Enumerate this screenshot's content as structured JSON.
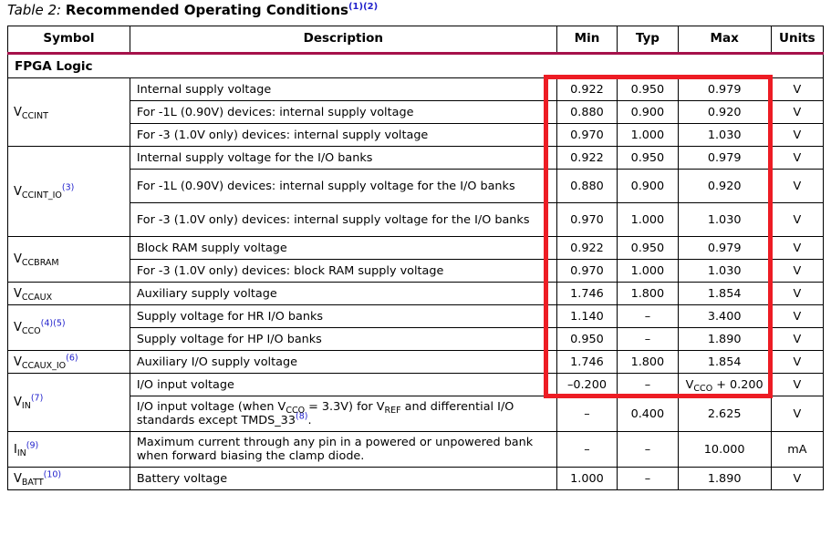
{
  "title": {
    "label": "Table  2:",
    "text": "Recommended Operating Conditions",
    "refs": "(1)(2)"
  },
  "columns": {
    "symbol": "Symbol",
    "description": "Description",
    "min": "Min",
    "typ": "Typ",
    "max": "Max",
    "units": "Units"
  },
  "section": {
    "fpga_logic": "FPGA Logic"
  },
  "symbols": {
    "vccint": {
      "base": "V",
      "sub": "CCINT",
      "refs": ""
    },
    "vccint_io": {
      "base": "V",
      "sub": "CCINT_IO",
      "refs": "(3)"
    },
    "vccbram": {
      "base": "V",
      "sub": "CCBRAM",
      "refs": ""
    },
    "vccaux": {
      "base": "V",
      "sub": "CCAUX",
      "refs": ""
    },
    "vcco": {
      "base": "V",
      "sub": "CCO",
      "refs": "(4)(5)"
    },
    "vccaux_io": {
      "base": "V",
      "sub": "CCAUX_IO",
      "refs": "(6)"
    },
    "vin": {
      "base": "V",
      "sub": "IN",
      "refs": "(7)"
    },
    "iin": {
      "base": "I",
      "sub": "IN",
      "refs": "(9)"
    },
    "vbatt": {
      "base": "V",
      "sub": "BATT",
      "refs": "(10)"
    }
  },
  "rows": [
    {
      "id": "vccint-1",
      "description": "Internal supply voltage",
      "min": "0.922",
      "typ": "0.950",
      "max": "0.979",
      "units": "V"
    },
    {
      "id": "vccint-2",
      "description": "For -1L (0.90V) devices: internal supply voltage",
      "min": "0.880",
      "typ": "0.900",
      "max": "0.920",
      "units": "V"
    },
    {
      "id": "vccint-3",
      "description": "For -3 (1.0V only) devices: internal supply voltage",
      "min": "0.970",
      "typ": "1.000",
      "max": "1.030",
      "units": "V"
    },
    {
      "id": "vccint-io-1",
      "description": "Internal supply voltage for the I/O banks",
      "min": "0.922",
      "typ": "0.950",
      "max": "0.979",
      "units": "V"
    },
    {
      "id": "vccint-io-2",
      "description": "For -1L (0.90V) devices: internal supply voltage for the I/O banks",
      "min": "0.880",
      "typ": "0.900",
      "max": "0.920",
      "units": "V"
    },
    {
      "id": "vccint-io-3",
      "description": "For -3 (1.0V only) devices: internal supply voltage for the I/O banks",
      "min": "0.970",
      "typ": "1.000",
      "max": "1.030",
      "units": "V"
    },
    {
      "id": "vccbram-1",
      "description": "Block RAM supply voltage",
      "min": "0.922",
      "typ": "0.950",
      "max": "0.979",
      "units": "V"
    },
    {
      "id": "vccbram-2",
      "description": "For -3 (1.0V only) devices: block RAM supply voltage",
      "min": "0.970",
      "typ": "1.000",
      "max": "1.030",
      "units": "V"
    },
    {
      "id": "vccaux-1",
      "description": "Auxiliary supply voltage",
      "min": "1.746",
      "typ": "1.800",
      "max": "1.854",
      "units": "V"
    },
    {
      "id": "vcco-1",
      "description": "Supply voltage for HR I/O banks",
      "min": "1.140",
      "typ": "–",
      "max": "3.400",
      "units": "V"
    },
    {
      "id": "vcco-2",
      "description": "Supply voltage for HP I/O banks",
      "min": "0.950",
      "typ": "–",
      "max": "1.890",
      "units": "V"
    },
    {
      "id": "vccaux-io-1",
      "description": "Auxiliary I/O supply voltage",
      "min": "1.746",
      "typ": "1.800",
      "max": "1.854",
      "units": "V"
    },
    {
      "id": "vin-1",
      "description": "I/O input voltage",
      "min": "–0.200",
      "typ": "–",
      "max_rich": true,
      "units": "V"
    },
    {
      "id": "vin-2",
      "description_rich": true,
      "min": "–",
      "typ": "0.400",
      "max": "2.625",
      "units": "V"
    },
    {
      "id": "iin-1",
      "description": "Maximum current through any pin in a powered or unpowered bank when forward biasing the clamp diode.",
      "min": "–",
      "typ": "–",
      "max": "10.000",
      "units": "mA"
    },
    {
      "id": "vbatt-1",
      "description": "Battery voltage",
      "min": "1.000",
      "typ": "–",
      "max": "1.890",
      "units": "V"
    }
  ],
  "inline": {
    "vin2_text_a": "I/O input voltage (when V",
    "vin2_sub_a": "CCO",
    "vin2_text_b": " = 3.3V) for V",
    "vin2_sub_b": "REF",
    "vin2_text_c": " and differential I/O standards except TMDS_33",
    "vin2_ref": "(8)",
    "vin2_text_d": ".",
    "vin1_max_base": "V",
    "vin1_max_sub": "CCO",
    "vin1_max_tail": " + 0.200"
  },
  "annotation": {
    "highlight_color": "#ED1C24",
    "header_rule_color": "#A5114A",
    "reference_color": "#2222CC"
  }
}
